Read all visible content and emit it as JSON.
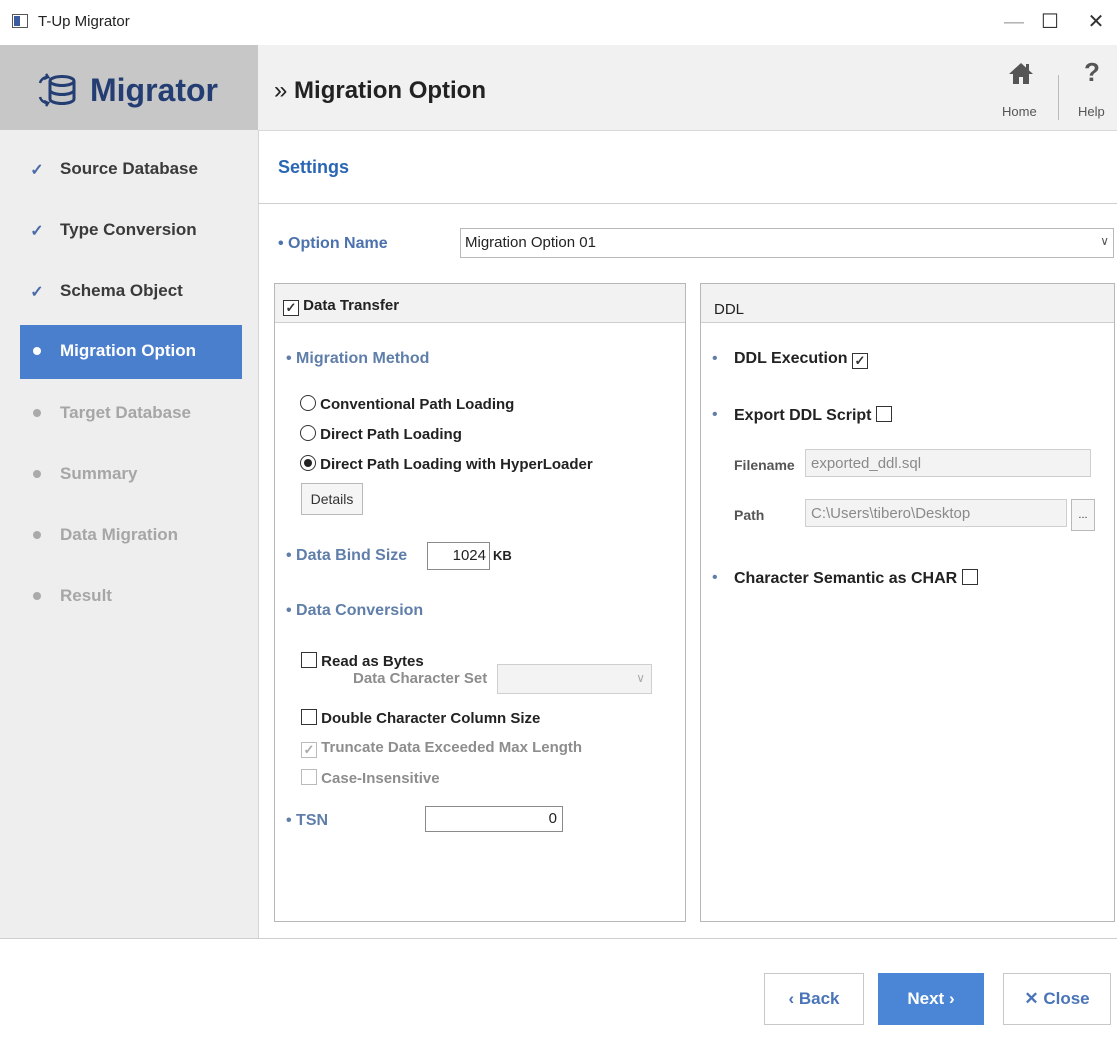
{
  "window": {
    "title": "T-Up Migrator",
    "minimize": "—",
    "maximize": "☐",
    "close": "✕"
  },
  "logo": {
    "text": "Migrator"
  },
  "header": {
    "prefix": "»",
    "title": "Migration Option",
    "home_label": "Home",
    "help_label": "Help"
  },
  "sidebar": {
    "items": [
      {
        "label": "Source Database",
        "state": "done"
      },
      {
        "label": "Type Conversion",
        "state": "done"
      },
      {
        "label": "Schema Object",
        "state": "done"
      },
      {
        "label": "Migration Option",
        "state": "active"
      },
      {
        "label": "Target Database",
        "state": "pending"
      },
      {
        "label": "Summary",
        "state": "pending"
      },
      {
        "label": "Data Migration",
        "state": "pending"
      },
      {
        "label": "Result",
        "state": "pending"
      }
    ]
  },
  "settings": {
    "title": "Settings",
    "option_name_label": "• Option Name",
    "option_name_value": "Migration Option 01",
    "dropdown_caret": "∨"
  },
  "data_transfer": {
    "title": "Data Transfer",
    "checked": true,
    "migration_method_label": "• Migration Method",
    "methods": [
      {
        "label": "Conventional Path Loading",
        "selected": false
      },
      {
        "label": "Direct Path Loading",
        "selected": false
      },
      {
        "label": "Direct Path Loading with HyperLoader",
        "selected": true
      }
    ],
    "details_button": "Details",
    "bind_size_label": "• Data Bind Size",
    "bind_size_value": "1024",
    "bind_size_unit": "KB",
    "data_conversion_label": "• Data Conversion",
    "read_as_bytes": {
      "label": "Read as Bytes",
      "checked": false
    },
    "charset_label": "Data Character Set",
    "charset_value": "",
    "double_char": {
      "label": "Double Character Column Size",
      "checked": false
    },
    "truncate": {
      "label": "Truncate Data Exceeded Max Length",
      "checked": true,
      "disabled": true
    },
    "case_insensitive": {
      "label": "Case-Insensitive",
      "checked": false,
      "disabled": true
    },
    "tsn_label": "• TSN",
    "tsn_value": "0"
  },
  "ddl": {
    "title": "DDL",
    "bullet": "•",
    "ddl_execution": {
      "label": "DDL Execution",
      "checked": true
    },
    "export_script": {
      "label": "Export DDL Script",
      "checked": false
    },
    "filename_label": "Filename",
    "filename_value": "exported_ddl.sql",
    "path_label": "Path",
    "path_value": "C:\\Users\\tibero\\Desktop",
    "browse_button": "...",
    "char_semantic": {
      "label": "Character Semantic as CHAR",
      "checked": false
    }
  },
  "footer": {
    "back_label": "‹ Back",
    "next_label": "Next ›",
    "close_label": "✕ Close"
  },
  "colors": {
    "accent": "#4a7fcd",
    "logo": "#243d73",
    "section": "#5f7ea9",
    "settings_title": "#2a66b4"
  }
}
